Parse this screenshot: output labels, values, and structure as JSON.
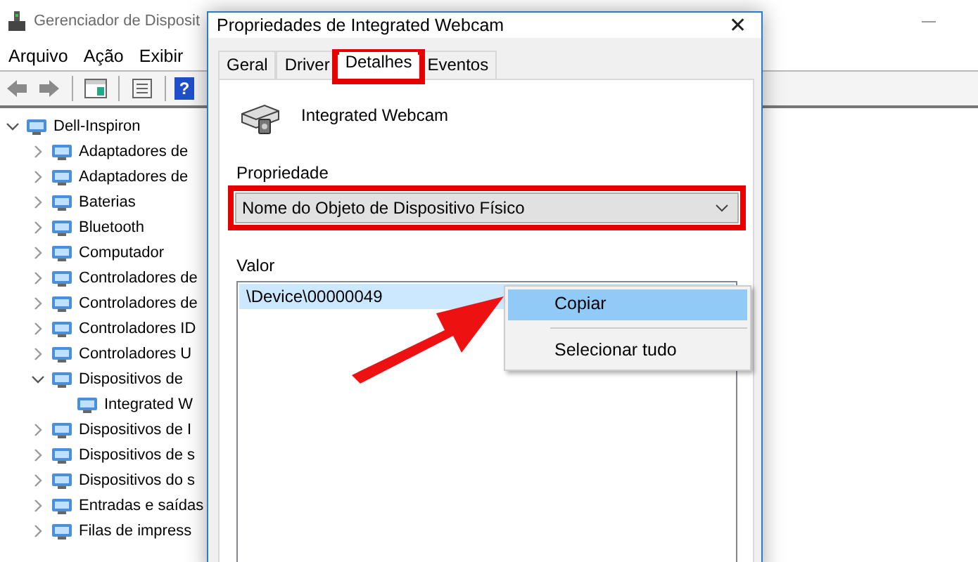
{
  "main_window": {
    "title": "Gerenciador de Disposit",
    "menu": [
      "Arquivo",
      "Ação",
      "Exibir"
    ],
    "help_glyph": "?",
    "tree": [
      {
        "label": "Dell-Inspiron",
        "expanded": true,
        "children": [
          {
            "label": "Adaptadores de",
            "expanded": false
          },
          {
            "label": "Adaptadores de",
            "expanded": false
          },
          {
            "label": "Baterias",
            "expanded": false
          },
          {
            "label": "Bluetooth",
            "expanded": false
          },
          {
            "label": "Computador",
            "expanded": false
          },
          {
            "label": "Controladores de",
            "expanded": false
          },
          {
            "label": "Controladores de",
            "expanded": false
          },
          {
            "label": "Controladores ID",
            "expanded": false
          },
          {
            "label": "Controladores U",
            "expanded": false
          },
          {
            "label": "Dispositivos de",
            "expanded": true,
            "children": [
              {
                "label": "Integrated W"
              }
            ]
          },
          {
            "label": "Dispositivos de I",
            "expanded": false
          },
          {
            "label": "Dispositivos de s",
            "expanded": false
          },
          {
            "label": "Dispositivos do s",
            "expanded": false
          },
          {
            "label": "Entradas e saídas",
            "expanded": false
          },
          {
            "label": "Filas de impress",
            "expanded": false
          }
        ]
      }
    ]
  },
  "dialog": {
    "title": "Propriedades de Integrated Webcam",
    "close": "✕",
    "tabs": [
      {
        "label": "Geral",
        "selected": false
      },
      {
        "label": "Driver",
        "selected": false
      },
      {
        "label": "Detalhes",
        "selected": true
      },
      {
        "label": "Eventos",
        "selected": false
      }
    ],
    "device_name": "Integrated Webcam",
    "property_label": "Propriedade",
    "property_value": "Nome do Objeto de Dispositivo Físico",
    "value_label": "Valor",
    "values": [
      {
        "text": "\\Device\\00000049",
        "selected": true
      }
    ]
  },
  "context_menu": [
    {
      "label": "Copiar",
      "selected": true
    },
    {
      "label": "Selecionar tudo",
      "selected": false
    }
  ]
}
